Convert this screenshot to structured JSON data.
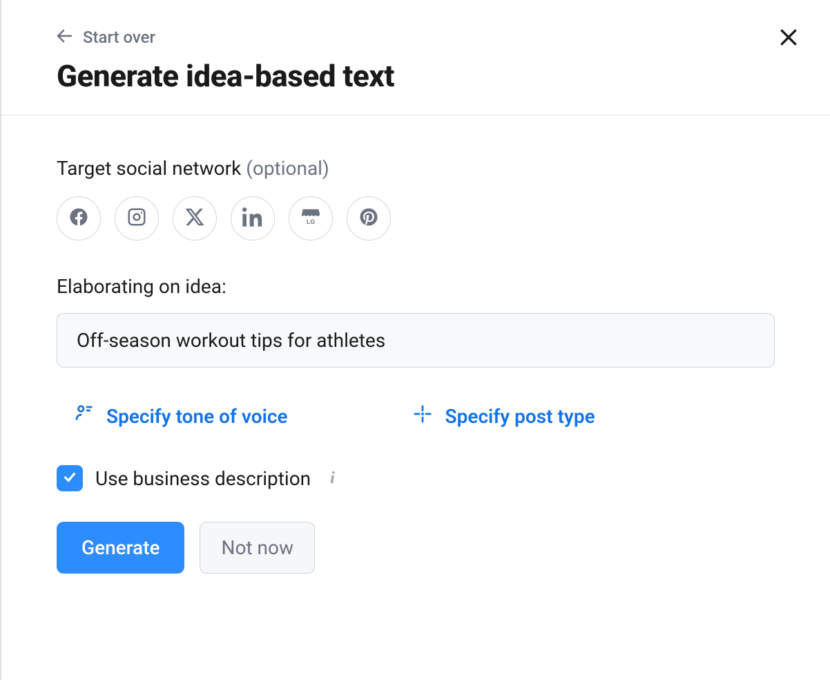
{
  "header": {
    "start_over_label": "Start over",
    "title": "Generate idea-based text"
  },
  "target_network": {
    "label": "Target social network",
    "optional_label": " (optional)",
    "networks": [
      "facebook",
      "instagram",
      "x",
      "linkedin",
      "google-business",
      "pinterest"
    ]
  },
  "idea": {
    "label": "Elaborating on idea:",
    "value": "Off-season workout tips for athletes"
  },
  "options": {
    "tone_label": "Specify tone of voice",
    "post_type_label": "Specify post type"
  },
  "business_desc": {
    "checked": true,
    "label": "Use business description"
  },
  "buttons": {
    "primary": "Generate",
    "secondary": "Not now"
  }
}
